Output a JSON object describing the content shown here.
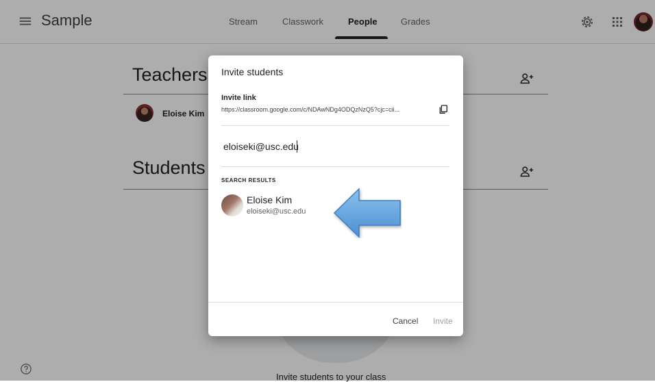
{
  "topbar": {
    "class_name": "Sample",
    "tabs": [
      {
        "label": "Stream"
      },
      {
        "label": "Classwork"
      },
      {
        "label": "People"
      },
      {
        "label": "Grades"
      }
    ],
    "active_tab": "People"
  },
  "people": {
    "teachers_heading": "Teachers",
    "students_heading": "Students",
    "teacher_name": "Eloise Kim",
    "invite_caption": "Invite students to your class"
  },
  "dialog": {
    "title": "Invite students",
    "invite_link_label": "Invite link",
    "invite_link_url": "https://classroom.google.com/c/NDAwNDg4ODQzNzQ5?cjc=cii...",
    "search_value": "eloiseki@usc.edu",
    "results_label": "SEARCH RESULTS",
    "result": {
      "name": "Eloise Kim",
      "email": "eloiseki@usc.edu"
    },
    "cancel_label": "Cancel",
    "invite_label": "Invite"
  },
  "colors": {
    "accent": "#202124",
    "annotation_arrow": "#5b9bd5",
    "scrim": "rgba(0,0,0,0.32)"
  },
  "icons": {
    "menu": "hamburger-menu-icon",
    "settings": "gear-icon",
    "apps": "apps-grid-icon",
    "person_add": "person-add-icon",
    "copy": "copy-icon",
    "help": "help-circle-icon"
  }
}
